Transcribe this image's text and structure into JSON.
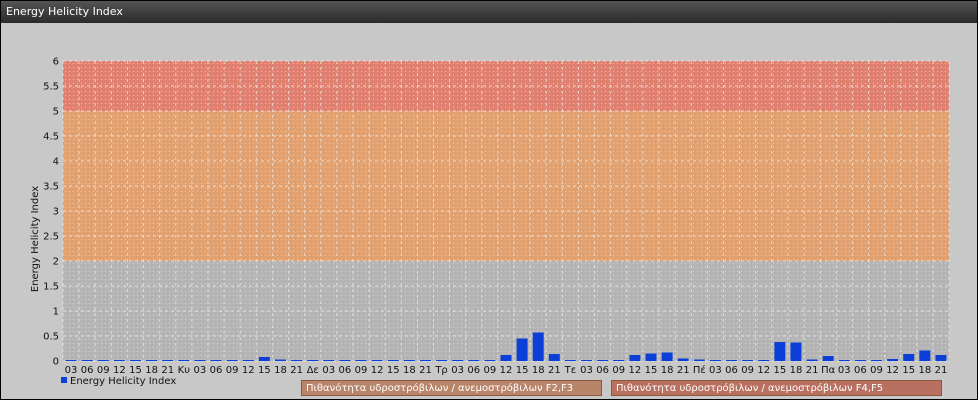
{
  "window": {
    "title": "Energy Helicity Index"
  },
  "chart_data": {
    "type": "bar",
    "title": "Energy Helicity Index",
    "ylabel": "Energy Helicity Index",
    "xlabel": "",
    "ylim": [
      0,
      6
    ],
    "yticks": [
      "0",
      "0.5",
      "1",
      "1.5",
      "2",
      "2.5",
      "3",
      "3.5",
      "4",
      "4.5",
      "5",
      "5.5",
      "6"
    ],
    "grid": true,
    "legend": "bottom-left",
    "categories": [
      "03",
      "06",
      "09",
      "12",
      "15",
      "18",
      "21",
      "Κυ",
      "03",
      "06",
      "09",
      "12",
      "15",
      "18",
      "21",
      "Δε",
      "03",
      "06",
      "09",
      "12",
      "15",
      "18",
      "21",
      "Τρ",
      "03",
      "06",
      "09",
      "12",
      "15",
      "18",
      "21",
      "Τε",
      "03",
      "06",
      "09",
      "12",
      "15",
      "18",
      "21",
      "Πέ",
      "03",
      "06",
      "09",
      "12",
      "15",
      "18",
      "21",
      "Πα",
      "03",
      "06",
      "09",
      "12",
      "15",
      "18",
      "21"
    ],
    "series": [
      {
        "name": "Energy Helicity Index",
        "color": "#0b3fd8",
        "values": [
          0.02,
          0.02,
          0.02,
          0.02,
          0.02,
          0.02,
          0.02,
          0.02,
          0.02,
          0.02,
          0.02,
          0.02,
          0.08,
          0.03,
          0.02,
          0.02,
          0.02,
          0.02,
          0.02,
          0.02,
          0.02,
          0.02,
          0.02,
          0.02,
          0.02,
          0.02,
          0.02,
          0.12,
          0.45,
          0.57,
          0.14,
          0.02,
          0.02,
          0.02,
          0.02,
          0.12,
          0.15,
          0.17,
          0.05,
          0.03,
          0.02,
          0.02,
          0.02,
          0.02,
          0.38,
          0.37,
          0.03,
          0.1,
          0.02,
          0.02,
          0.02,
          0.04,
          0.14,
          0.21,
          0.12
        ]
      }
    ],
    "bands": [
      {
        "label": "Πιθανότητα υδροστρόβιλων / ανεμοστρόβιλων F2,F3",
        "from": 2,
        "to": 5,
        "color": "#e0a070"
      },
      {
        "label": "Πιθανότητα υδροστρόβιλων / ανεμοστρόβιλων F4,F5",
        "from": 5,
        "to": 6,
        "color": "#e08070"
      }
    ]
  }
}
